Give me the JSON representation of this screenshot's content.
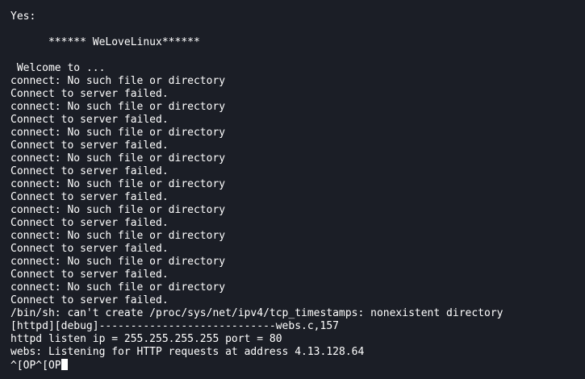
{
  "terminal": {
    "lines": [
      "Yes:",
      "      ****** WeLoveLinux******",
      " Welcome to ...",
      "connect: No such file or directory",
      "Connect to server failed.",
      "connect: No such file or directory",
      "Connect to server failed.",
      "connect: No such file or directory",
      "Connect to server failed.",
      "connect: No such file or directory",
      "Connect to server failed.",
      "connect: No such file or directory",
      "Connect to server failed.",
      "connect: No such file or directory",
      "Connect to server failed.",
      "connect: No such file or directory",
      "Connect to server failed.",
      "connect: No such file or directory",
      "Connect to server failed.",
      "connect: No such file or directory",
      "Connect to server failed.",
      "/bin/sh: can't create /proc/sys/net/ipv4/tcp_timestamps: nonexistent directory",
      "[httpd][debug]----------------------------webs.c,157",
      "httpd listen ip = 255.255.255.255 port = 80",
      "webs: Listening for HTTP requests at address 4.13.128.64"
    ],
    "input_line": "^[OP^[OP",
    "colors": {
      "background": "#1b1e26",
      "text": "#ffffff",
      "cursor": "#ffffff"
    },
    "icons": {
      "cursor": "block-cursor-icon"
    }
  }
}
